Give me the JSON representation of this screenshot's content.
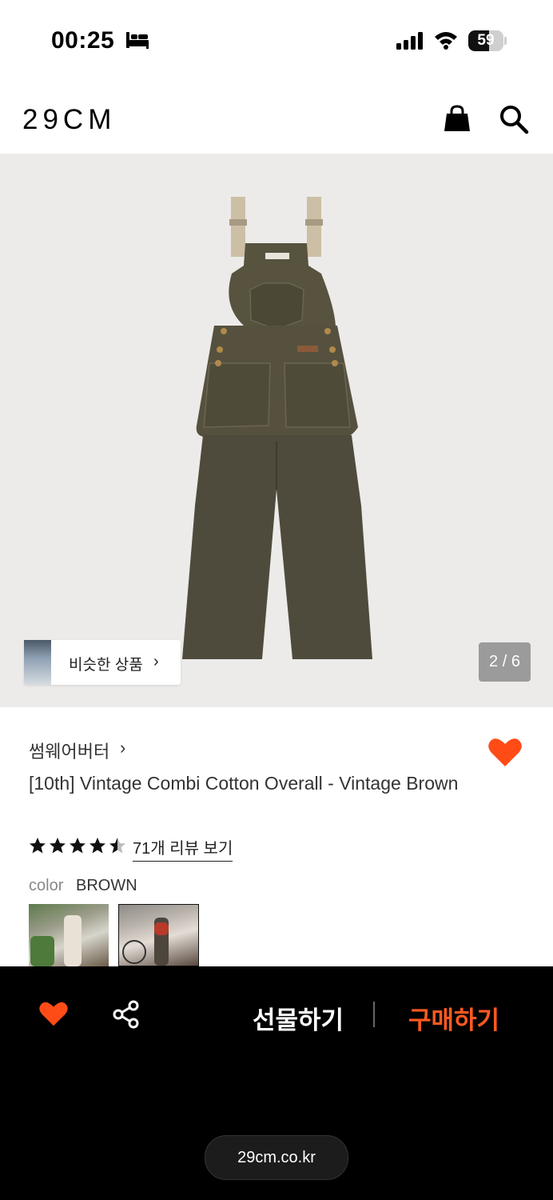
{
  "status_bar": {
    "time": "00:25",
    "battery_level": "59",
    "icons": [
      "bed-icon",
      "signal-icon",
      "wifi-icon",
      "battery-icon"
    ]
  },
  "header": {
    "logo": "29CM",
    "icons": [
      "shopping-bag-icon",
      "search-icon"
    ]
  },
  "gallery": {
    "similar_label": "비슷한 상품",
    "similar_chevron": "›",
    "counter": "2 / 6",
    "current_index": 2,
    "total": 6
  },
  "product": {
    "brand": "썸웨어버터",
    "brand_chevron": "›",
    "title": "[10th] Vintage Combi Cotton Overall - Vintage Brown",
    "rating": 4.5,
    "review_link": "71개 리뷰 보기",
    "color_key": "color",
    "color_value": "BROWN",
    "accent": "#ff5a1f"
  },
  "bottom_bar": {
    "gift_label": "선물하기",
    "buy_label": "구매하기",
    "url": "29cm.co.kr",
    "icons": [
      "heart-icon",
      "share-icon"
    ]
  }
}
